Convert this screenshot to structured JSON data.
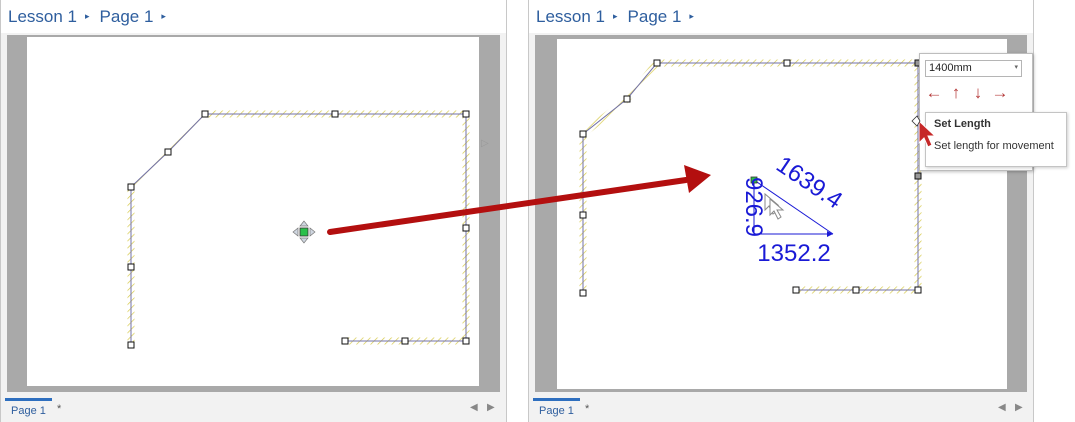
{
  "panes": [
    {
      "breadcrumb": [
        "Lesson 1",
        "Page 1"
      ],
      "footer_tab": "Page 1",
      "footer_star": "*"
    },
    {
      "breadcrumb": [
        "Lesson 1",
        "Page 1"
      ],
      "footer_tab": "Page 1",
      "footer_star": "*"
    }
  ],
  "popup": {
    "length_value": "1400mm",
    "arrow_buttons": [
      "←",
      "↑",
      "↓",
      "→"
    ]
  },
  "tooltip": {
    "title": "Set Length",
    "description": "Set length for movement"
  },
  "measurements": {
    "vertical": "926.9",
    "horizontal": "1352.2",
    "diagonal": "1639.4"
  },
  "colors": {
    "accent": "#2e5e9e",
    "arrow": "#b30f0f",
    "dimension": "#1a1ad6",
    "wall_hatch": "#d6c94a"
  },
  "icons": {
    "breadcrumb_separator": "▸",
    "nav_prev": "◀",
    "nav_next": "▶",
    "dropdown": "▾",
    "scroll_hint": "▷"
  }
}
